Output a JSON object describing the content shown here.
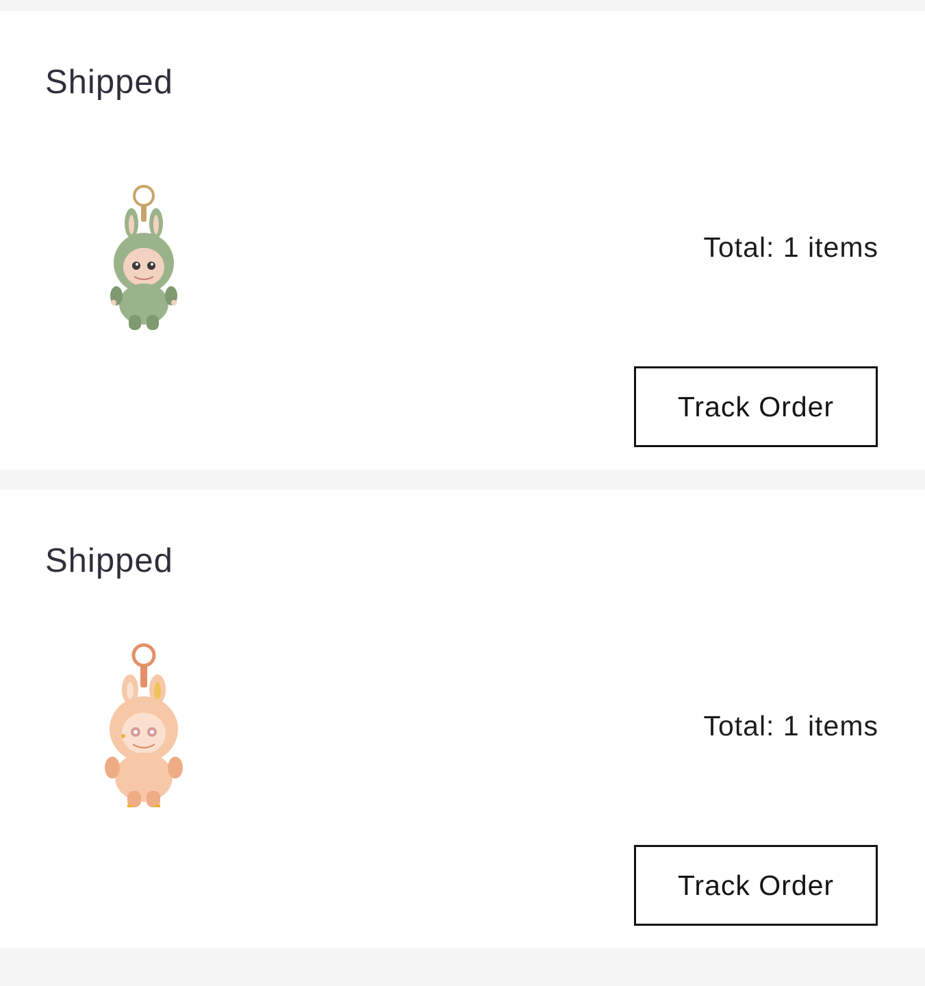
{
  "orders": [
    {
      "status": "Shipped",
      "total_text": "Total: 1 items",
      "action_label": "Track Order",
      "product_image": "green-bunny-plush-keychain",
      "colors": {
        "body": "#9bb38a",
        "body_dark": "#7f9a70",
        "face": "#f3d2c1",
        "ring": "#c9a46a"
      }
    },
    {
      "status": "Shipped",
      "total_text": "Total: 1 items",
      "action_label": "Track Order",
      "product_image": "peach-bunny-plush-keychain",
      "colors": {
        "body": "#f7c8a8",
        "body_dark": "#eeac85",
        "face": "#fbe0cf",
        "ring": "#e4906a"
      }
    }
  ]
}
